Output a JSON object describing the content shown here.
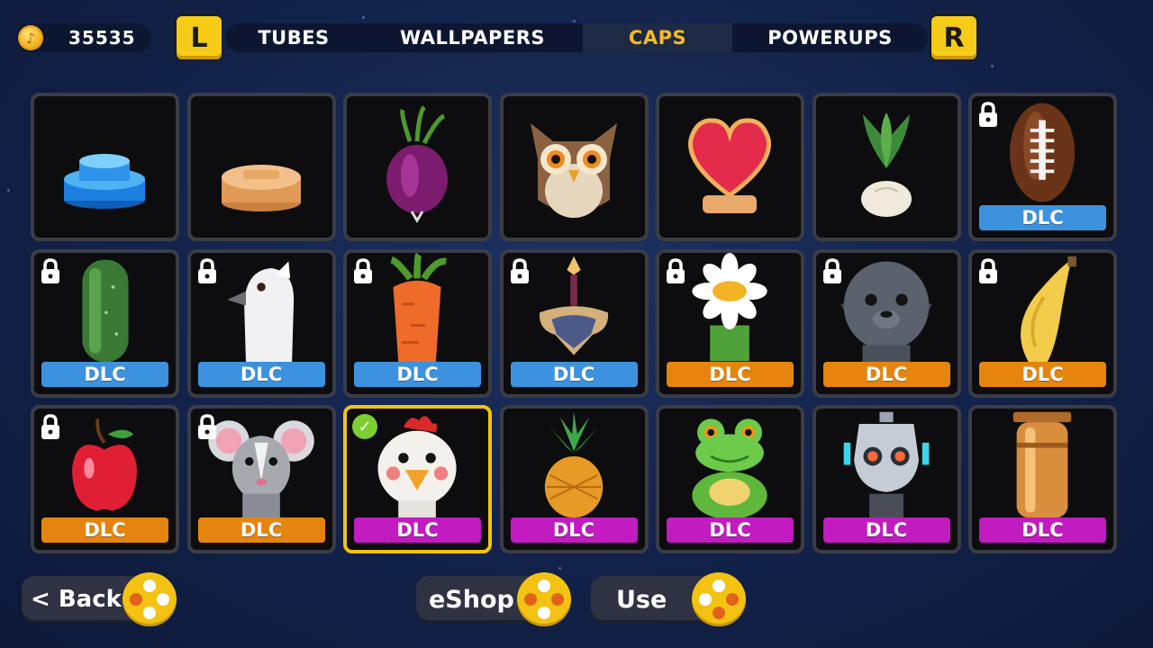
{
  "coins": {
    "value": "35535"
  },
  "shoulders": {
    "left": "L",
    "right": "R"
  },
  "tabs": [
    {
      "label": "TUBES",
      "active": false
    },
    {
      "label": "WALLPAPERS",
      "active": false
    },
    {
      "label": "CAPS",
      "active": true
    },
    {
      "label": "POWERUPS",
      "active": false
    }
  ],
  "caps": [
    {
      "icon": "blue-cap-icon",
      "locked": false,
      "dlc": null
    },
    {
      "icon": "wooden-cap-icon",
      "locked": false,
      "dlc": null
    },
    {
      "icon": "red-onion-icon",
      "locked": false,
      "dlc": null
    },
    {
      "icon": "owl-icon",
      "locked": false,
      "dlc": null
    },
    {
      "icon": "heart-icon",
      "locked": false,
      "dlc": null
    },
    {
      "icon": "garlic-icon",
      "locked": false,
      "dlc": null
    },
    {
      "icon": "football-icon",
      "locked": true,
      "dlc": "DLC",
      "dlc_color": "blue"
    },
    {
      "icon": "cucumber-icon",
      "locked": true,
      "dlc": "DLC",
      "dlc_color": "blue"
    },
    {
      "icon": "bird-icon",
      "locked": true,
      "dlc": "DLC",
      "dlc_color": "blue"
    },
    {
      "icon": "carrot-icon",
      "locked": true,
      "dlc": "DLC",
      "dlc_color": "blue"
    },
    {
      "icon": "sword-icon",
      "locked": true,
      "dlc": "DLC",
      "dlc_color": "blue"
    },
    {
      "icon": "daisy-icon",
      "locked": true,
      "dlc": "DLC",
      "dlc_color": "orange"
    },
    {
      "icon": "seal-icon",
      "locked": true,
      "dlc": "DLC",
      "dlc_color": "orange"
    },
    {
      "icon": "banana-icon",
      "locked": true,
      "dlc": "DLC",
      "dlc_color": "orange"
    },
    {
      "icon": "apple-icon",
      "locked": true,
      "dlc": "DLC",
      "dlc_color": "orange"
    },
    {
      "icon": "mouse-icon",
      "locked": true,
      "dlc": "DLC",
      "dlc_color": "orange"
    },
    {
      "icon": "chicken-icon",
      "locked": false,
      "selected": true,
      "dlc": "DLC",
      "dlc_color": "magenta"
    },
    {
      "icon": "pineapple-icon",
      "locked": false,
      "dlc": "DLC",
      "dlc_color": "magenta"
    },
    {
      "icon": "frog-icon",
      "locked": false,
      "dlc": "DLC",
      "dlc_color": "magenta"
    },
    {
      "icon": "robot-icon",
      "locked": false,
      "dlc": "DLC",
      "dlc_color": "magenta"
    },
    {
      "icon": "bullet-icon",
      "locked": false,
      "dlc": "DLC",
      "dlc_color": "magenta"
    }
  ],
  "buttons": {
    "back": "< Back",
    "eshop": "eShop",
    "use": "Use"
  },
  "colors": {
    "accent": "#f7b928",
    "dlc_blue": "#3c92de",
    "dlc_orange": "#e5850e",
    "dlc_magenta": "#c21bc1",
    "selected_border": "#f1c40f"
  }
}
